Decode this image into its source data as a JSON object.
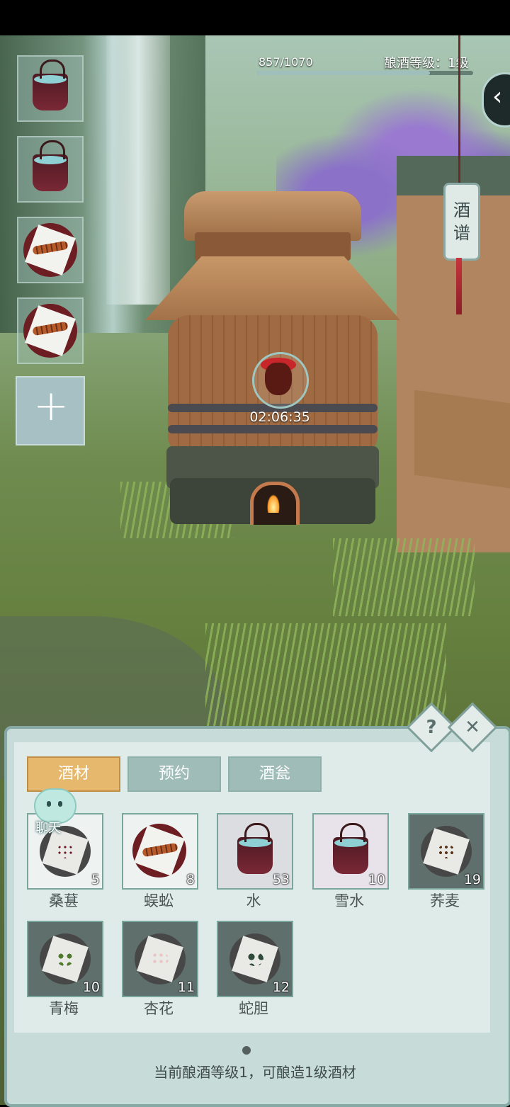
{
  "hud": {
    "progress_text": "857/1070",
    "progress_value": 857,
    "progress_max": 1070,
    "level_text": "酿酒等级：1级",
    "recipe_tag": "酒谱",
    "back_icon": "chevron-left-icon"
  },
  "barrel": {
    "timer": "02:06:35"
  },
  "side_slots": [
    {
      "type": "bucket"
    },
    {
      "type": "bucket"
    },
    {
      "type": "centipede"
    },
    {
      "type": "centipede"
    }
  ],
  "panel": {
    "tabs": [
      "酒材",
      "预约",
      "酒瓮"
    ],
    "active_tab": 0,
    "chat_label": "聊天",
    "footer": "当前酿酒等级1，可酿造1级酒材"
  },
  "items": [
    {
      "name": "桑葚",
      "count": "5"
    },
    {
      "name": "蜈蚣",
      "count": "8"
    },
    {
      "name": "水",
      "count": "53"
    },
    {
      "name": "雪水",
      "count": "10"
    },
    {
      "name": "荞麦",
      "count": "19"
    },
    {
      "name": "青梅",
      "count": "10"
    },
    {
      "name": "杏花",
      "count": "11"
    },
    {
      "name": "蛇胆",
      "count": "12"
    }
  ],
  "colors": {
    "panel_bg": "#c7dcd9",
    "tab_active": "#e6b86d",
    "tab_inactive": "#9fbcb9"
  }
}
